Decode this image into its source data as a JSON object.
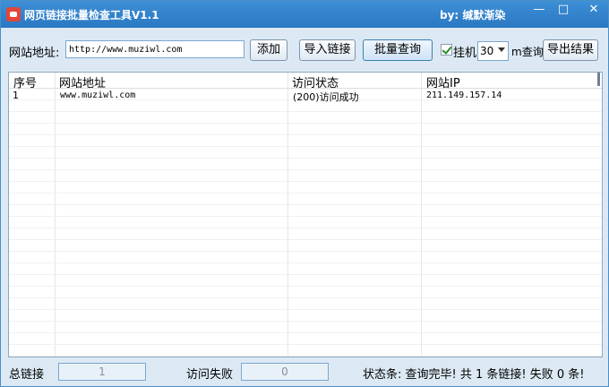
{
  "window": {
    "title": "网页链接批量检查工具V1.1",
    "author": "by: 缄默渐染",
    "minimize": "—",
    "maximize": "□",
    "close": "✕"
  },
  "toolbar": {
    "url_label": "网站地址:",
    "url_value": "http://www.muziwl.com",
    "add_label": "添加",
    "import_label": "导入链接",
    "batch_query_label": "批量查询",
    "hang_label": "挂机",
    "hang_checked": true,
    "interval_value": "30",
    "interval_unit_label": "m查询",
    "export_label": "导出结果"
  },
  "table": {
    "headers": [
      "序号",
      "网站地址",
      "访问状态",
      "网站IP"
    ],
    "rows": [
      [
        "1",
        "www.muziwl.com",
        "(200)访问成功",
        "211.149.157.14"
      ]
    ]
  },
  "status": {
    "total_label": "总链接",
    "total_value": "1",
    "fail_label": "访问失败",
    "fail_value": "0",
    "status_text": "状态条: 查询完毕! 共 1 条链接! 失败 0 条!"
  },
  "colors": {
    "titlebar": "#2a78c2",
    "window_bg": "#dce9f4",
    "accent_border": "#7aa7cf"
  }
}
